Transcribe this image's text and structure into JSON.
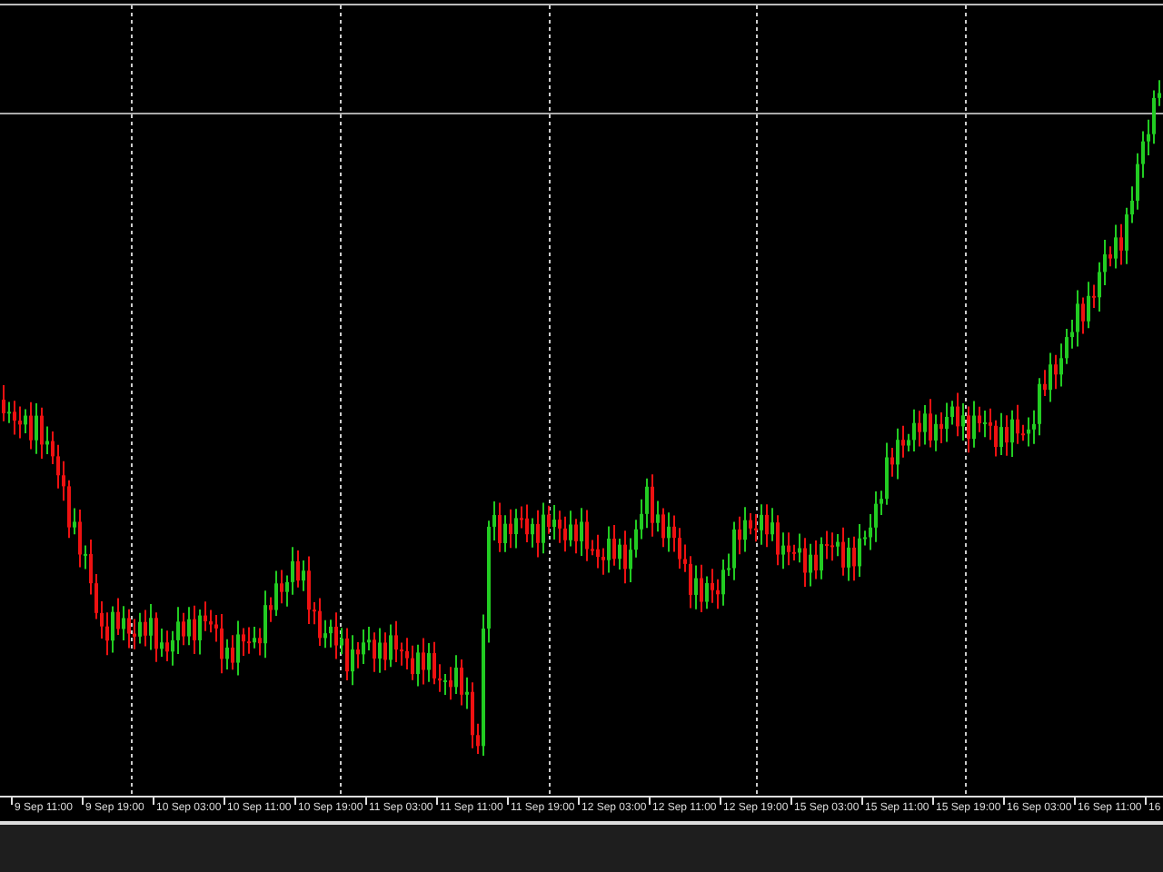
{
  "chart": {
    "kind": "candlestick"
  },
  "time_axis": {
    "labels": [
      "9 Sep 11:00",
      "9 Sep 19:00",
      "10 Sep 03:00",
      "10 Sep 11:00",
      "10 Sep 19:00",
      "11 Sep 03:00",
      "11 Sep 11:00",
      "11 Sep 19:00",
      "12 Sep 03:00",
      "12 Sep 11:00",
      "12 Sep 19:00",
      "15 Sep 03:00",
      "15 Sep 11:00",
      "15 Sep 19:00",
      "16 Sep 03:00",
      "16 Sep 11:00",
      "16"
    ]
  }
}
